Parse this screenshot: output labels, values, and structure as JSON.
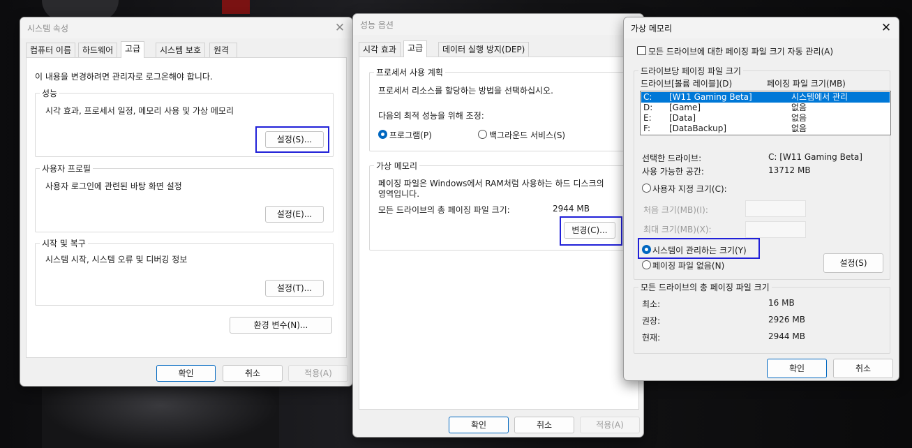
{
  "sys": {
    "title": "시스템 속성",
    "tabs": [
      "컴퓨터 이름",
      "하드웨어",
      "고급",
      "시스템 보호",
      "원격"
    ],
    "admin_note": "이 내용을 변경하려면 관리자로 로그온해야 합니다.",
    "perf_legend": "성능",
    "perf_desc": "시각 효과, 프로세서 일정, 메모리 사용 및 가상 메모리",
    "perf_btn": "설정(S)...",
    "profile_legend": "사용자 프로필",
    "profile_desc": "사용자 로그인에 관련된 바탕 화면 설정",
    "profile_btn": "설정(E)...",
    "startup_legend": "시작 및 복구",
    "startup_desc": "시스템 시작, 시스템 오류 및 디버깅 정보",
    "startup_btn": "설정(T)...",
    "env_btn": "환경 변수(N)...",
    "ok": "확인",
    "cancel": "취소",
    "apply": "적용(A)"
  },
  "perf": {
    "title": "성능 옵션",
    "tabs": [
      "시각 효과",
      "고급",
      "데이터 실행 방지(DEP)"
    ],
    "sched_legend": "프로세서 사용 계획",
    "sched_desc": "프로세서 리소스를 할당하는 방법을 선택하십시오.",
    "adjust_label": "다음의 최적 성능을 위해 조정:",
    "opt_programs": "프로그램(P)",
    "opt_background": "백그라운드 서비스(S)",
    "vm_legend": "가상 메모리",
    "vm_desc_line1": "페이징 파일은 Windows에서 RAM처럼 사용하는 하드 디스크의",
    "vm_desc_line2": "영역입니다.",
    "vm_total_label": "모든 드라이브의 총 페이징 파일 크기:",
    "vm_total_value": "2944 MB",
    "change_btn": "변경(C)...",
    "ok": "확인",
    "cancel": "취소",
    "apply": "적용(A)"
  },
  "vm": {
    "title": "가상 메모리",
    "auto_manage": "모든 드라이브에 대한 페이징 파일 크기 자동 관리(A)",
    "per_drive_legend": "드라이브당 페이징 파일 크기",
    "col_drive": "드라이브[볼륨 레이블](D)",
    "col_size": "페이징 파일 크기(MB)",
    "drives": [
      {
        "letter": "C:",
        "label": "[W11 Gaming Beta]",
        "size": "시스템에서 관리"
      },
      {
        "letter": "D:",
        "label": "[Game]",
        "size": "없음"
      },
      {
        "letter": "E:",
        "label": "[Data]",
        "size": "없음"
      },
      {
        "letter": "F:",
        "label": "[DataBackup]",
        "size": "없음"
      }
    ],
    "sel_drive_label": "선택한 드라이브:",
    "sel_drive_value": "C:  [W11 Gaming Beta]",
    "free_label": "사용 가능한 공간:",
    "free_value": "13712 MB",
    "opt_custom": "사용자 지정 크기(C):",
    "initial_label": "처음 크기(MB)(I):",
    "max_label": "최대 크기(MB)(X):",
    "opt_system": "시스템이 관리하는 크기(Y)",
    "opt_none": "페이징 파일 없음(N)",
    "set_btn": "설정(S)",
    "total_legend": "모든 드라이브의 총 페이징 파일 크기",
    "min_label": "최소:",
    "min_value": "16 MB",
    "rec_label": "권장:",
    "rec_value": "2926 MB",
    "cur_label": "현재:",
    "cur_value": "2944 MB",
    "ok": "확인",
    "cancel": "취소"
  }
}
